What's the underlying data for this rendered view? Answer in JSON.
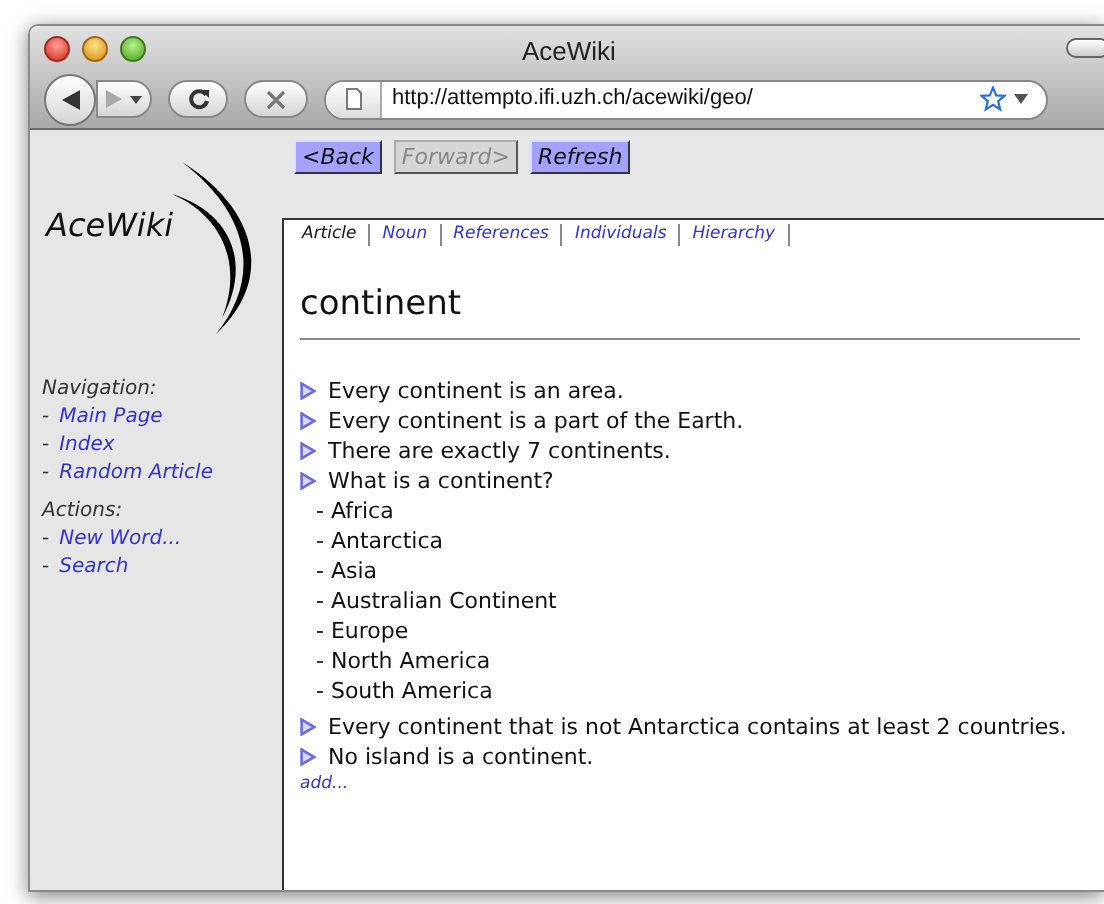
{
  "window": {
    "title": "AceWiki"
  },
  "address_bar": {
    "url": "http://attempto.ifi.uzh.ch/acewiki/geo/"
  },
  "nav_buttons": [
    {
      "label": "<Back",
      "disabled": false
    },
    {
      "label": "Forward>",
      "disabled": true
    },
    {
      "label": "Refresh",
      "disabled": false
    }
  ],
  "logo": {
    "text": "AceWiki"
  },
  "sidebar": {
    "sections": [
      {
        "heading": "Navigation:",
        "items": [
          {
            "bullet": "-",
            "label": "Main Page"
          },
          {
            "bullet": "-",
            "label": "Index"
          },
          {
            "bullet": "-",
            "label": "Random Article"
          }
        ]
      },
      {
        "heading": "Actions:",
        "items": [
          {
            "bullet": "-",
            "label": "New Word..."
          },
          {
            "bullet": "-",
            "label": "Search"
          }
        ]
      }
    ]
  },
  "tabs": [
    {
      "label": "Article",
      "selected": true
    },
    {
      "label": "Noun",
      "selected": false
    },
    {
      "label": "References",
      "selected": false
    },
    {
      "label": "Individuals",
      "selected": false
    },
    {
      "label": "Hierarchy",
      "selected": false
    }
  ],
  "article": {
    "title": "continent",
    "sentences": [
      {
        "kind": "statement",
        "text": "Every continent is an area."
      },
      {
        "kind": "statement",
        "text": "Every continent is a part of the Earth."
      },
      {
        "kind": "statement",
        "text": "There are exactly 7 continents."
      },
      {
        "kind": "question",
        "text": "What is a continent?",
        "answers": [
          "- Africa",
          "- Antarctica",
          "- Asia",
          "- Australian Continent",
          "- Europe",
          "- North America",
          "- South America"
        ]
      },
      {
        "kind": "statement",
        "text": "Every continent that is not Antarctica contains at least 2 countries."
      },
      {
        "kind": "statement",
        "text": "No island is a continent."
      }
    ],
    "add_link": "add..."
  }
}
